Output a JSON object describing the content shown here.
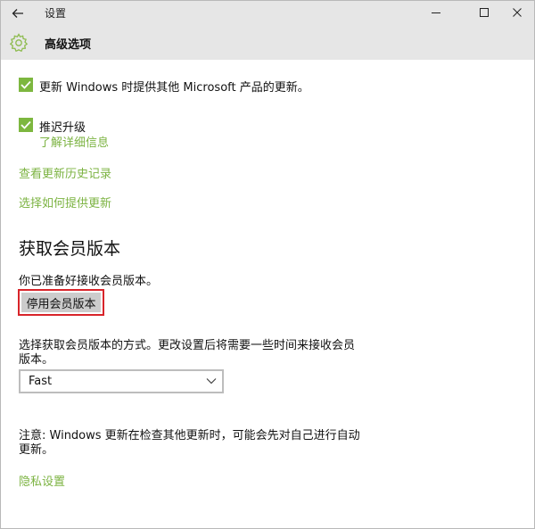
{
  "window": {
    "app_title": "设置",
    "page_title": "高级选项",
    "controls": {
      "back": "back-arrow-icon",
      "minimize": "minimize-icon",
      "maximize": "maximize-icon",
      "close": "close-icon"
    }
  },
  "options": {
    "microsoft_updates": {
      "label": "更新 Windows 时提供其他 Microsoft 产品的更新。",
      "checked": true
    },
    "defer_upgrades": {
      "label": "推迟升级",
      "checked": true,
      "link": "了解详细信息"
    }
  },
  "links": {
    "update_history": "查看更新历史记录",
    "choose_delivery": "选择如何提供更新"
  },
  "insider": {
    "heading": "获取会员版本",
    "ready_text": "你已准备好接收会员版本。",
    "stop_button": "停用会员版本",
    "ring_description_line1": "选择获取会员版本的方式。更改设置后将需要一些时间来接收会员",
    "ring_description_line2": "版本。",
    "ring_select": {
      "value": "Fast"
    }
  },
  "note": {
    "line1": "注意: Windows 更新在检查其他更新时，可能会先对自己进行自动",
    "line2": "更新。"
  },
  "footer_link": "隐私设置",
  "colors": {
    "accent": "#7cb342",
    "checkbox": "#7db73f",
    "highlight_border": "#d8242a",
    "titlebar": "#e6e6e6"
  }
}
